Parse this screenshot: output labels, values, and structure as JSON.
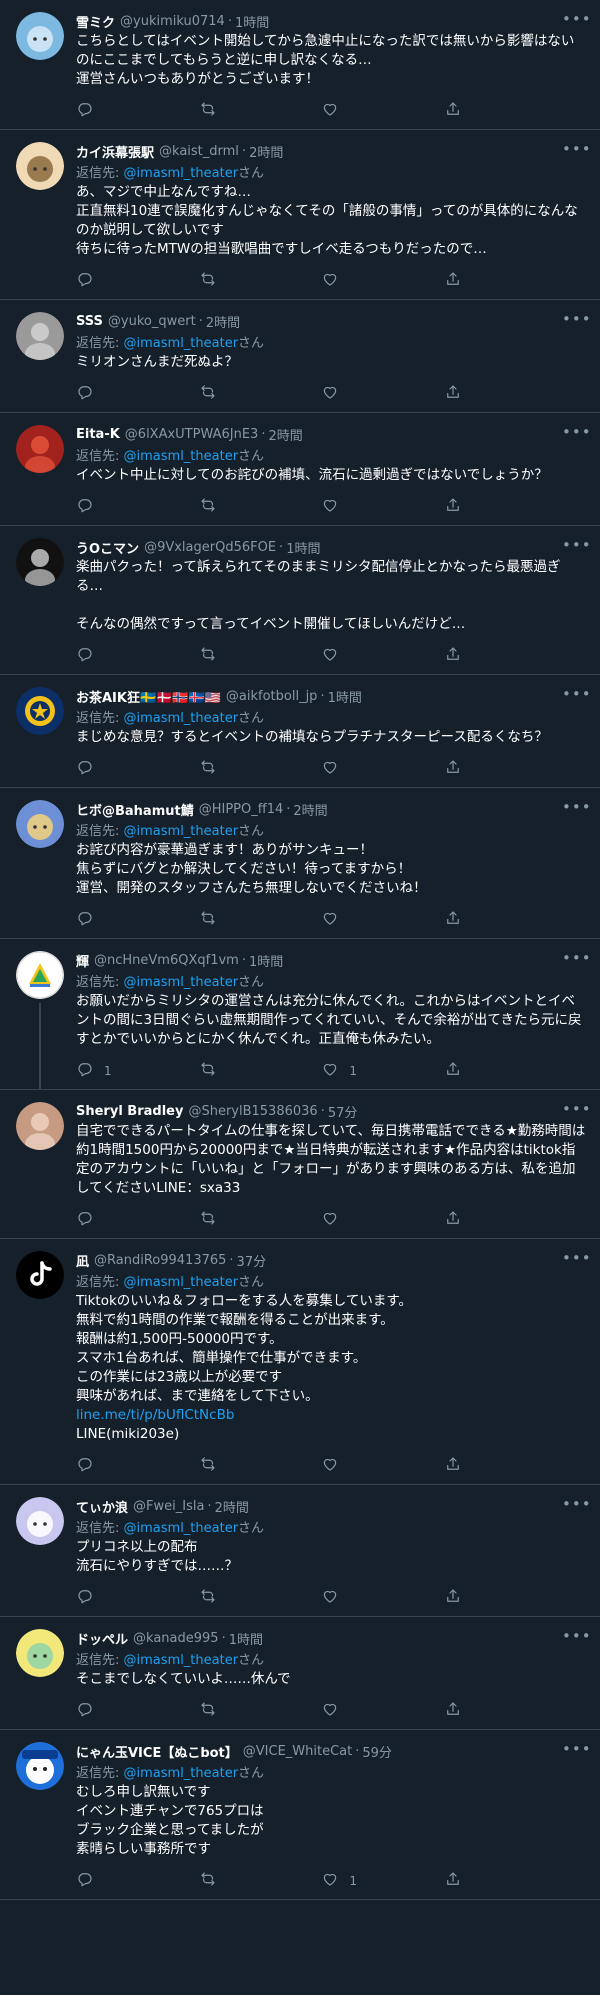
{
  "colors": {
    "background": "#15202b",
    "divider": "#38444d",
    "text": "#ffffff",
    "secondary_text": "#8899a6",
    "link": "#1da1f2"
  },
  "tweets": [
    {
      "name": "雪ミク",
      "handle": "@yukimiku0714",
      "time": "1時間",
      "reply_to": "",
      "body": "こちらとしてはイベント開始してから急遽中止になった訳では無いから影響はないのにここまでしてもらうと逆に申し訳なくなる…\n運営さんいつもありがとうございます！",
      "link": "",
      "extra": "",
      "reply_count": "",
      "like_count": "",
      "avatar_colors": [
        "#7cb8e0",
        "#d8eaf7"
      ],
      "avatar_icon": "illustration-avatar",
      "thread": false
    },
    {
      "name": "カイ浜幕張駅",
      "handle": "@kaist_drml",
      "time": "2時間",
      "reply_to": "@imasml_theater",
      "body": "あ、マジで中止なんですね…\n正直無料10連で誤魔化すんじゃなくてその「諸般の事情」ってのが具体的になんなのか説明して欲しいです\n待ちに待ったMTWの担当歌唱曲ですしイベ走るつもりだったので…",
      "link": "",
      "extra": "",
      "reply_count": "",
      "like_count": "",
      "avatar_colors": [
        "#f0d9b5",
        "#8a6a3d"
      ],
      "avatar_icon": "illustration-avatar",
      "thread": false
    },
    {
      "name": "SSS",
      "handle": "@yuko_qwert",
      "time": "2時間",
      "reply_to": "@imasml_theater",
      "body": "ミリオンさんまだ死ぬよ？",
      "link": "",
      "extra": "",
      "reply_count": "",
      "like_count": "",
      "avatar_colors": [
        "#9a9a9a",
        "#d6d6d6"
      ],
      "avatar_icon": "photo-avatar",
      "thread": false
    },
    {
      "name": "Eita-K",
      "handle": "@6lXAxUTPWA6JnE3",
      "time": "2時間",
      "reply_to": "@imasml_theater",
      "body": "イベント中止に対してのお詫びの補填、流石に過剰過ぎではないでしょうか？",
      "link": "",
      "extra": "",
      "reply_count": "",
      "like_count": "",
      "avatar_colors": [
        "#a2231d",
        "#e8553d"
      ],
      "avatar_icon": "photo-avatar",
      "thread": false
    },
    {
      "name": "うOこマン",
      "handle": "@9VxlagerQd56FOE",
      "time": "1時間",
      "reply_to": "",
      "body": "楽曲パクった！って訴えられてそのままミリシタ配信停止とかなったら最悪過ぎる…\n\nそんなの偶然ですって言ってイベント開催してほしいんだけど…",
      "link": "",
      "extra": "",
      "reply_count": "",
      "like_count": "",
      "avatar_colors": [
        "#111111",
        "#cfcfcf"
      ],
      "avatar_icon": "photo-avatar",
      "thread": false
    },
    {
      "name": "お茶AIK狂🇸🇪🇩🇰🇳🇴🇮🇸🇺🇸",
      "handle": "@aikfotboll_jp",
      "time": "1時間",
      "reply_to": "@imasml_theater",
      "body": "まじめな意見？するとイベントの補填ならプラチナスターピース配るくなち？",
      "link": "",
      "extra": "",
      "reply_count": "",
      "like_count": "",
      "avatar_colors": [
        "#0b2f66",
        "#f3c21a"
      ],
      "avatar_icon": "crest-avatar",
      "thread": false
    },
    {
      "name": "ヒボ@Bahamut鯖",
      "handle": "@HIPPO_ff14",
      "time": "2時間",
      "reply_to": "@imasml_theater",
      "body": "お詫び内容が豪華過ぎます！ありがサンキュー！\n焦らずにバグとか解決してください！待ってますから！\n運営、開発のスタッフさんたち無理しないでくださいね！",
      "link": "",
      "extra": "",
      "reply_count": "",
      "like_count": "",
      "avatar_colors": [
        "#6d8fd6",
        "#f3d27a"
      ],
      "avatar_icon": "illustration-avatar",
      "thread": false
    },
    {
      "name": "輝",
      "handle": "@ncHneVm6QXqf1vm",
      "time": "1時間",
      "reply_to": "@imasml_theater",
      "body": "お願いだからミリシタの運営さんは充分に休んでくれ。これからはイベントとイベントの間に3日間ぐらい虚無期間作ってくれていい、そんで余裕が出てきたら元に戻すとかでいいからとにかく休んでくれ。正直俺も休みたい。",
      "link": "",
      "extra": "",
      "reply_count": "1",
      "like_count": "1",
      "avatar_colors": [
        "#ffffff",
        "#27a35a"
      ],
      "avatar_icon": "triangle-logo-avatar",
      "thread": true
    },
    {
      "name": "Sheryl Bradley",
      "handle": "@SherylB15386036",
      "time": "57分",
      "reply_to": "",
      "body": "自宅でできるパートタイムの仕事を探していて、毎日携帯電話でできる★勤務時間は約1時間1500円から20000円まで★当日特典が転送されます★作品内容はtiktok指定のアカウントに「いいね」と「フォロー」があります興味のある方は、私を追加してくださいLINE：sxa33",
      "link": "",
      "extra": "",
      "reply_count": "",
      "like_count": "",
      "avatar_colors": [
        "#c79a82",
        "#f1d6c6"
      ],
      "avatar_icon": "photo-avatar",
      "thread": false
    },
    {
      "name": "凪",
      "handle": "@RandiRo99413765",
      "time": "37分",
      "reply_to": "@imasml_theater",
      "body": "Tiktokのいいね＆フォローをする人を募集しています。\n無料で約1時間の作業で報酬を得ることが出来ます。\n報酬は約1,500円-50000円です。\nスマホ1台あれば、簡単操作で仕事ができます。\nこの作業には23歳以上が必要です\n興味があれば、まで連絡をして下さい。",
      "link": "line.me/ti/p/bUflCtNcBb",
      "extra": "LINE(miki203e)",
      "reply_count": "",
      "like_count": "",
      "avatar_colors": [
        "#000000",
        "#ffffff"
      ],
      "avatar_icon": "tiktok-logo-avatar",
      "thread": false
    },
    {
      "name": "てぃか浪",
      "handle": "@Fwei_Isla",
      "time": "2時間",
      "reply_to": "@imasml_theater",
      "body": "プリコネ以上の配布\n流石にやりすぎでは……？",
      "link": "",
      "extra": "",
      "reply_count": "",
      "like_count": "",
      "avatar_colors": [
        "#c9c7f0",
        "#ffffff"
      ],
      "avatar_icon": "illustration-avatar",
      "thread": false
    },
    {
      "name": "ドッペル",
      "handle": "@kanade995",
      "time": "1時間",
      "reply_to": "@imasml_theater",
      "body": "そこまでしなくていいよ……休んで",
      "link": "",
      "extra": "",
      "reply_count": "",
      "like_count": "",
      "avatar_colors": [
        "#f2e87a",
        "#8fd3a8"
      ],
      "avatar_icon": "illustration-avatar",
      "thread": false
    },
    {
      "name": "にゃん玉VICE【ぬこbot】",
      "handle": "@VICE_WhiteCat",
      "time": "59分",
      "reply_to": "@imasml_theater",
      "body": "むしろ申し訳無いです\nイベント連チャンで765プロは\nブラック企業と思ってましたが\n素晴らしい事務所です",
      "link": "",
      "extra": "",
      "reply_count": "",
      "like_count": "1",
      "avatar_colors": [
        "#1e6fd9",
        "#ffffff"
      ],
      "avatar_icon": "mascot-avatar",
      "thread": false
    }
  ],
  "labels": {
    "reply_prefix": "返信先: ",
    "reply_suffix": "さん",
    "separator": "·"
  }
}
